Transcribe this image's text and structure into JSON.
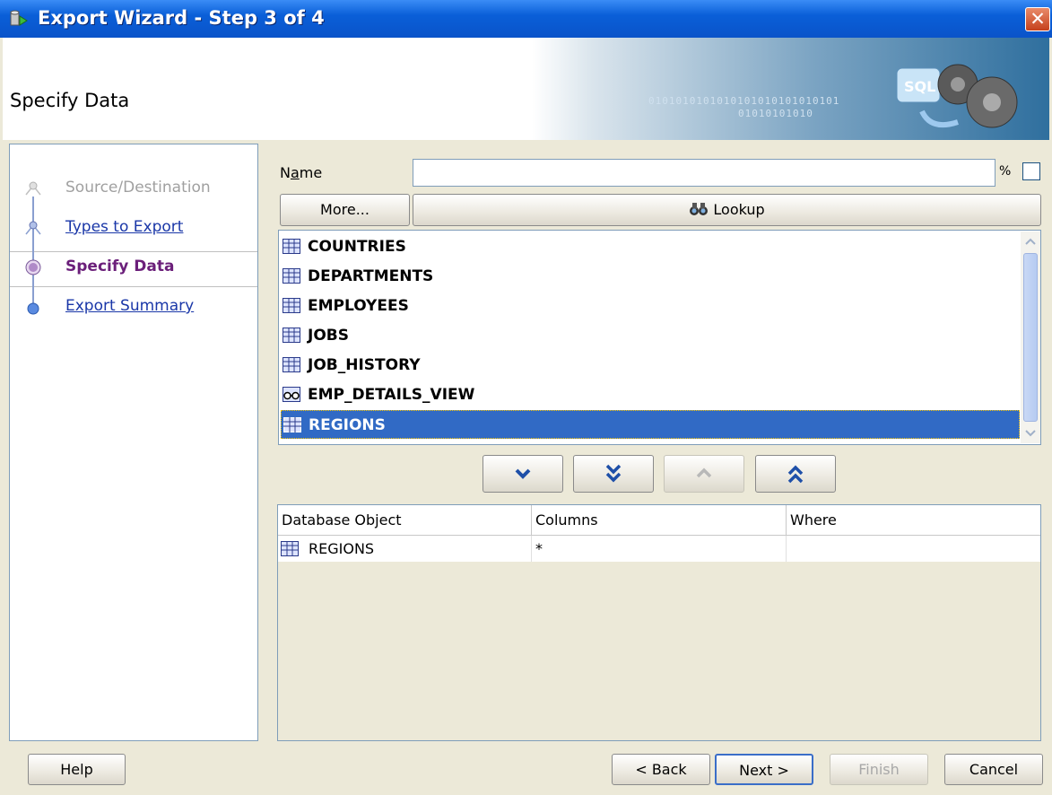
{
  "window": {
    "title": "Export Wizard - Step 3 of 4",
    "close_glyph": "✕"
  },
  "header": {
    "title": "Specify Data",
    "binary_text": "0101010101010101010101010101",
    "binary_text2": "01010101010"
  },
  "steps": [
    {
      "label": "Source/Destination",
      "state": "disabled"
    },
    {
      "label": "Types to Export",
      "state": "link"
    },
    {
      "label": "Specify Data",
      "state": "current"
    },
    {
      "label": "Export Summary",
      "state": "link"
    }
  ],
  "filter": {
    "name_label": "Name",
    "name_mnemonic": "a",
    "name_value": "",
    "percent": "%",
    "more_label": "More...",
    "lookup_label": "Lookup"
  },
  "objects": [
    {
      "name": "COUNTRIES",
      "kind": "table"
    },
    {
      "name": "DEPARTMENTS",
      "kind": "table"
    },
    {
      "name": "EMPLOYEES",
      "kind": "table"
    },
    {
      "name": "JOBS",
      "kind": "table"
    },
    {
      "name": "JOB_HISTORY",
      "kind": "table"
    },
    {
      "name": "EMP_DETAILS_VIEW",
      "kind": "view"
    },
    {
      "name": "REGIONS",
      "kind": "table",
      "selected": true
    }
  ],
  "move_buttons": [
    {
      "name": "move-selected-down-button",
      "icon": "chevron-down-icon",
      "enabled": true
    },
    {
      "name": "move-all-down-button",
      "icon": "double-chevron-down-icon",
      "enabled": true
    },
    {
      "name": "move-selected-up-button",
      "icon": "chevron-up-icon",
      "enabled": false
    },
    {
      "name": "move-all-up-button",
      "icon": "double-chevron-up-icon",
      "enabled": true
    }
  ],
  "selected_table": {
    "headers": [
      "Database Object",
      "Columns",
      "Where"
    ],
    "rows": [
      {
        "object": "REGIONS",
        "columns": "*",
        "where": ""
      }
    ]
  },
  "footer": {
    "help": "Help",
    "back": "< Back",
    "next": "Next >",
    "finish": "Finish",
    "cancel": "Cancel"
  },
  "colors": {
    "titlebar": "#0a5fd8",
    "selection": "#316ac5",
    "current_step": "#6b1f7a",
    "link": "#1a37a8"
  }
}
